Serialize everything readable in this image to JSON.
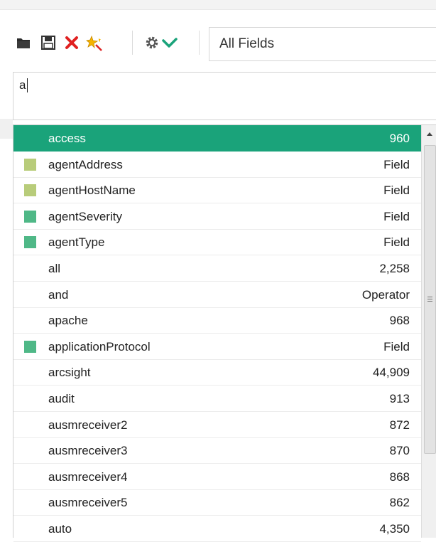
{
  "toolbar": {
    "field_select": {
      "value": "All Fields"
    }
  },
  "query": {
    "value": "a"
  },
  "suggestions": [
    {
      "term": "access",
      "value": "960",
      "swatch": null,
      "selected": true
    },
    {
      "term": "agentAddress",
      "value": "Field",
      "swatch": "#b8cc7a",
      "selected": false
    },
    {
      "term": "agentHostName",
      "value": "Field",
      "swatch": "#b8cc7a",
      "selected": false
    },
    {
      "term": "agentSeverity",
      "value": "Field",
      "swatch": "#4fb887",
      "selected": false
    },
    {
      "term": "agentType",
      "value": "Field",
      "swatch": "#4fb887",
      "selected": false
    },
    {
      "term": "all",
      "value": "2,258",
      "swatch": null,
      "selected": false
    },
    {
      "term": "and",
      "value": "Operator",
      "swatch": null,
      "selected": false
    },
    {
      "term": "apache",
      "value": "968",
      "swatch": null,
      "selected": false
    },
    {
      "term": "applicationProtocol",
      "value": "Field",
      "swatch": "#4fb887",
      "selected": false
    },
    {
      "term": "arcsight",
      "value": "44,909",
      "swatch": null,
      "selected": false
    },
    {
      "term": "audit",
      "value": "913",
      "swatch": null,
      "selected": false
    },
    {
      "term": "ausmreceiver2",
      "value": "872",
      "swatch": null,
      "selected": false
    },
    {
      "term": "ausmreceiver3",
      "value": "870",
      "swatch": null,
      "selected": false
    },
    {
      "term": "ausmreceiver4",
      "value": "868",
      "swatch": null,
      "selected": false
    },
    {
      "term": "ausmreceiver5",
      "value": "862",
      "swatch": null,
      "selected": false
    },
    {
      "term": "auto",
      "value": "4,350",
      "swatch": null,
      "selected": false
    }
  ],
  "colors": {
    "selected_row": "#1aa37a",
    "accent_check": "#1aa37a"
  }
}
